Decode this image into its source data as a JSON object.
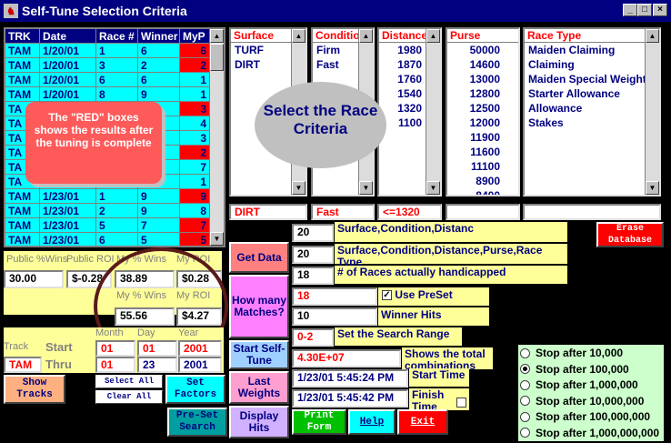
{
  "window": {
    "title": "Self-Tune Selection Criteria",
    "icon": "app-icon",
    "min": "_",
    "max": "□",
    "close": "×"
  },
  "grid": {
    "headers": [
      "TRK",
      "Date",
      "Race #",
      "Winner",
      "MyP"
    ],
    "rows": [
      [
        "TAM",
        "1/20/01",
        "1",
        "6",
        "6",
        true
      ],
      [
        "TAM",
        "1/20/01",
        "3",
        "2",
        "2",
        true
      ],
      [
        "TAM",
        "1/20/01",
        "6",
        "6",
        "1",
        false
      ],
      [
        "TAM",
        "1/20/01",
        "8",
        "9",
        "1",
        false
      ],
      [
        "TA",
        "",
        "",
        "",
        "3",
        true
      ],
      [
        "TA",
        "",
        "",
        "",
        "4",
        false
      ],
      [
        "TA",
        "",
        "",
        "",
        "3",
        false
      ],
      [
        "TA",
        "",
        "",
        "",
        "2",
        true
      ],
      [
        "TA",
        "",
        "",
        "",
        "7",
        false
      ],
      [
        "TA",
        "",
        "",
        "",
        "1",
        false
      ],
      [
        "TAM",
        "1/23/01",
        "1",
        "9",
        "9",
        true
      ],
      [
        "TAM",
        "1/23/01",
        "2",
        "9",
        "8",
        false
      ],
      [
        "TAM",
        "1/23/01",
        "5",
        "7",
        "7",
        true
      ],
      [
        "TAM",
        "1/23/01",
        "6",
        "5",
        "5",
        true
      ]
    ]
  },
  "callout_red": "The \"RED\" boxes shows the results after the tuning is complete",
  "callout_select": "Select the Race Criteria",
  "lists": {
    "surface": {
      "header": "Surface",
      "items": [
        "TURF",
        "DIRT"
      ],
      "selected": "DIRT"
    },
    "condition": {
      "header": "Condition",
      "items": [
        "Firm",
        "Fast"
      ],
      "selected": "Fast"
    },
    "distance": {
      "header": "Distance",
      "items": [
        "1980",
        "1870",
        "1760",
        "1540",
        "1320",
        "1100"
      ],
      "selected": "<=1320"
    },
    "purse": {
      "header": "Purse",
      "items": [
        "50000",
        "14600",
        "13000",
        "12800",
        "12500",
        "12000",
        "11900",
        "11600",
        "11100",
        "8900",
        "8400"
      ],
      "selected": ""
    },
    "race_type": {
      "header": "Race Type",
      "items": [
        "Maiden Claiming",
        "Claiming",
        "Maiden Special Weight",
        "Starter Allowance",
        "Allowance",
        "Stakes"
      ],
      "selected": ""
    }
  },
  "stats": {
    "public_wins_label": "Public %Wins",
    "public_roi_label": "Public ROI",
    "my_wins_label": "My % Wins",
    "my_roi_label": "My ROI",
    "public_wins": "30.00",
    "public_roi": "$-0.28",
    "my_wins": "38.89",
    "my_roi": "$0.28",
    "my_wins2_label": "My % Wins",
    "my_roi2_label": "My ROI",
    "my_wins2": "55.56",
    "my_roi2": "$4.27"
  },
  "dates": {
    "month_label": "Month",
    "day_label": "Day",
    "year_label": "Year",
    "track_label": "Track",
    "start_label": "Start",
    "thru_label": "Thru",
    "track": "TAM",
    "start_month": "01",
    "start_day": "01",
    "start_year": "2001",
    "thru_month": "01",
    "thru_day": "23",
    "thru_year": "2001"
  },
  "buttons": {
    "get_data": "Get Data",
    "how_many": "How many Matches?",
    "start_tune": "Start Self-Tune",
    "last_weights": "Last Weights",
    "display_hits": "Display Hits",
    "show_tracks": "Show Tracks",
    "select_all": "Select All",
    "clear_all": "Clear All",
    "set_factors": "Set Factors",
    "preset_search": "Pre-Set Search",
    "print_form": "Print Form",
    "help": "Help",
    "exit": "Exit",
    "erase_db": "Erase Database"
  },
  "fields": {
    "count1": "20",
    "count1_label": "Surface,Condition,Distanc",
    "count2": "20",
    "count2_label": "Surface,Condition,Distance,Purse,Race Type",
    "count3": "18",
    "count3_label": "# of Races actually handicapped",
    "preset": "18",
    "preset_label": "Use PreSet",
    "winner_hits": "10",
    "winner_hits_label": "Winner Hits",
    "range": "0-2",
    "range_label": "Set the Search Range",
    "combos": "4.30E+07",
    "combos_label": "Shows the total combinations",
    "start_time": "1/23/01 5:45:24 PM",
    "start_time_label": "Start Time",
    "finish_time": "1/23/01 5:45:42 PM",
    "finish_time_label": "Finish Time"
  },
  "stop_options": [
    "Stop after 10,000",
    "Stop after 100,000",
    "Stop after 1,000,000",
    "Stop after 10,000,000",
    "Stop after 100,000,000",
    "Stop after 1,000,000,000"
  ],
  "stop_selected": 1
}
